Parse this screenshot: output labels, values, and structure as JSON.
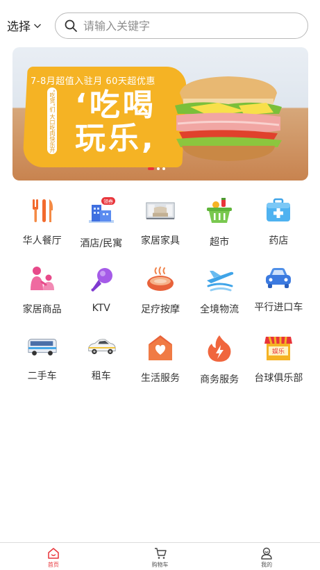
{
  "header": {
    "city_label": "选择",
    "search_placeholder": "请输入关键字"
  },
  "banner": {
    "subtitle": "7-8月超值入驻月  60天超优惠",
    "headline_line1": "‘吃喝",
    "headline_line2": "玩乐,",
    "vertical_text": "“吃货”们  大口吃肉快乐开业",
    "slides": 3,
    "active_slide": 1
  },
  "categories": [
    {
      "label": "华人餐厅",
      "icon": "fork-knife-icon"
    },
    {
      "label": "酒店/民寓",
      "icon": "hotel-building-icon",
      "badge": "领券"
    },
    {
      "label": "家居家具",
      "icon": "sofa-icon"
    },
    {
      "label": "超市",
      "icon": "shopping-basket-icon"
    },
    {
      "label": "药店",
      "icon": "medicine-box-icon"
    },
    {
      "label": "家居商品",
      "icon": "family-icon"
    },
    {
      "label": "KTV",
      "icon": "microphone-icon"
    },
    {
      "label": "足疗按摩",
      "icon": "foot-bath-icon"
    },
    {
      "label": "全境物流",
      "icon": "airplane-icon"
    },
    {
      "label": "平行进口车",
      "icon": "car-icon"
    },
    {
      "label": "二手车",
      "icon": "bus-icon"
    },
    {
      "label": "租车",
      "icon": "taxi-icon"
    },
    {
      "label": "生活服务",
      "icon": "house-heart-icon"
    },
    {
      "label": "商务服务",
      "icon": "flame-icon"
    },
    {
      "label": "台球俱乐部",
      "icon": "entertainment-shop-icon",
      "badge": "娱乐"
    }
  ],
  "tabbar": [
    {
      "label": "首页",
      "icon": "home-icon",
      "active": true
    },
    {
      "label": "购物车",
      "icon": "cart-icon",
      "active": false
    },
    {
      "label": "我的",
      "icon": "user-icon",
      "active": false
    }
  ],
  "colors": {
    "accent": "#e8343a",
    "banner_yellow": "#f5b324"
  }
}
